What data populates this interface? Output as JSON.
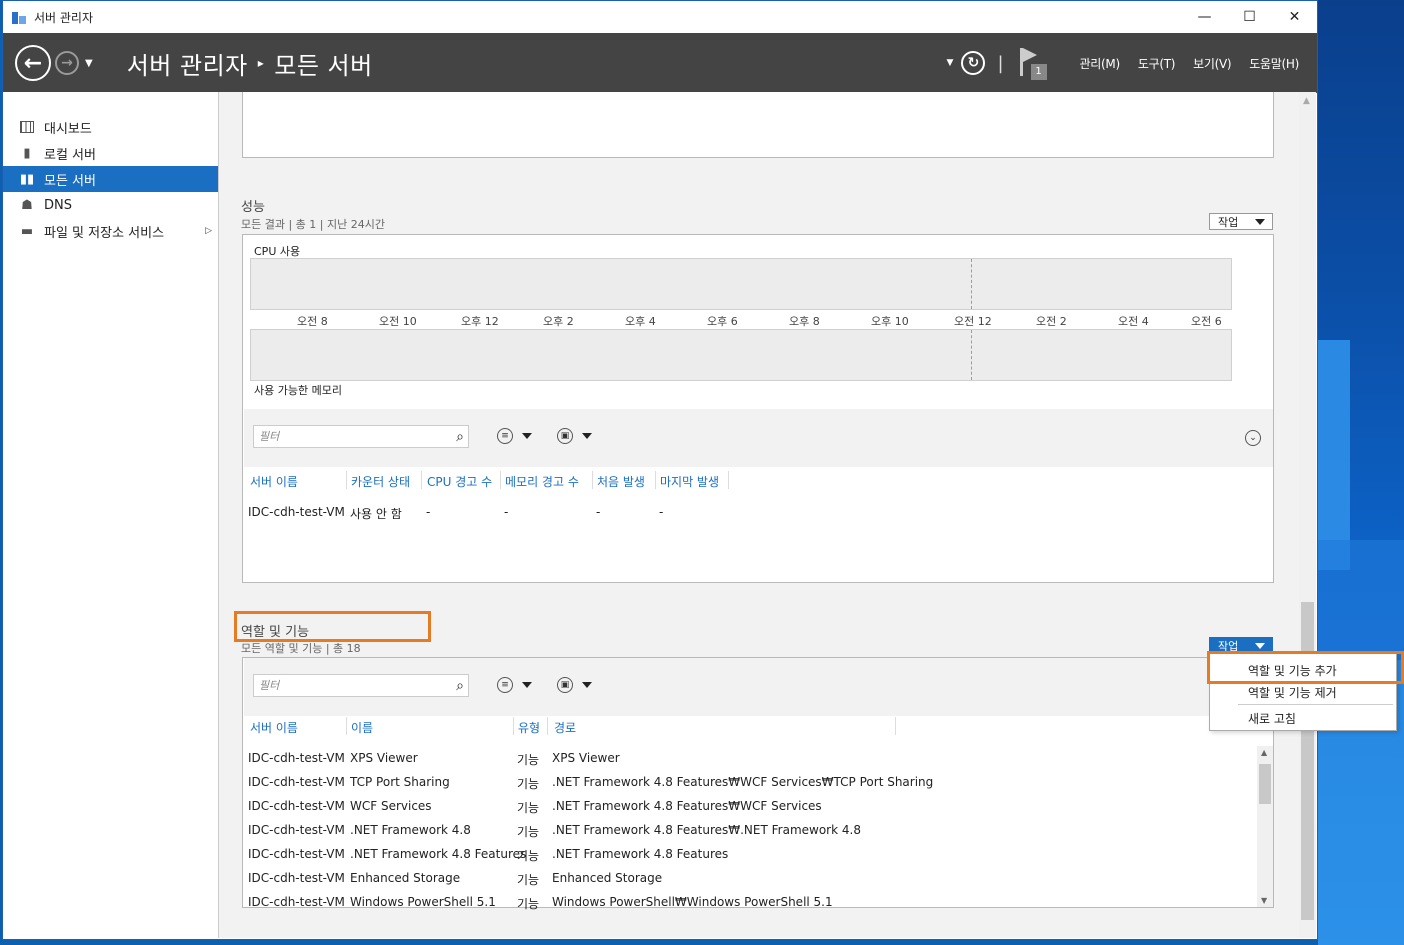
{
  "window": {
    "title": "서버 관리자",
    "minimize": "—",
    "maximize": "☐",
    "close": "✕"
  },
  "header": {
    "breadcrumb_root": "서버 관리자",
    "breadcrumb_sep": "▸",
    "breadcrumb_current": "모든 서버",
    "notification_count": "1",
    "menus": [
      "관리(M)",
      "도구(T)",
      "보기(V)",
      "도움말(H)"
    ]
  },
  "sidebar": {
    "items": [
      {
        "label": "대시보드",
        "icon": "dashboard-icon"
      },
      {
        "label": "로컬 서버",
        "icon": "server-icon"
      },
      {
        "label": "모든 서버",
        "icon": "servers-icon",
        "active": true
      },
      {
        "label": "DNS",
        "icon": "dns-icon"
      },
      {
        "label": "파일 및 저장소 서비스",
        "icon": "storage-icon",
        "has_submenu": true
      }
    ]
  },
  "performance": {
    "title": "성능",
    "subtitle": "모든 결과 | 총 1  |  지난 24시간",
    "task_label": "작업",
    "cpu_label": "CPU 사용",
    "memory_label": "사용 가능한 메모리",
    "time_ticks": [
      "오전 8",
      "오전 10",
      "오후 12",
      "오후 2",
      "오후 4",
      "오후 6",
      "오후 8",
      "오후 10",
      "오전 12",
      "오전 2",
      "오전 4",
      "오전 6"
    ],
    "filter_placeholder": "필터",
    "columns": [
      "서버 이름",
      "카운터 상태",
      "CPU 경고 수",
      "메모리 경고 수",
      "처음 발생",
      "마지막 발생"
    ],
    "rows": [
      [
        "IDC-cdh-test-VM",
        "사용 안 함",
        "-",
        "-",
        "-",
        "-"
      ]
    ]
  },
  "roles": {
    "title": "역할 및 기능",
    "subtitle": "모든 역할 및 기능 | 총 18",
    "task_label": "작업",
    "filter_placeholder": "필터",
    "columns": [
      "서버 이름",
      "이름",
      "유형",
      "경로"
    ],
    "rows": [
      [
        "IDC-cdh-test-VM",
        "XPS Viewer",
        "기능",
        "XPS Viewer"
      ],
      [
        "IDC-cdh-test-VM",
        "TCP Port Sharing",
        "기능",
        ".NET Framework 4.8 Features₩WCF Services₩TCP Port Sharing"
      ],
      [
        "IDC-cdh-test-VM",
        "WCF Services",
        "기능",
        ".NET Framework 4.8 Features₩WCF Services"
      ],
      [
        "IDC-cdh-test-VM",
        ".NET Framework 4.8",
        "기능",
        ".NET Framework 4.8 Features₩.NET Framework 4.8"
      ],
      [
        "IDC-cdh-test-VM",
        ".NET Framework 4.8 Features",
        "기능",
        ".NET Framework 4.8 Features"
      ],
      [
        "IDC-cdh-test-VM",
        "Enhanced Storage",
        "기능",
        "Enhanced Storage"
      ],
      [
        "IDC-cdh-test-VM",
        "Windows PowerShell 5.1",
        "기능",
        "Windows PowerShell₩Windows PowerShell 5.1"
      ]
    ]
  },
  "task_menu": {
    "items": [
      "역할 및 기능 추가",
      "역할 및 기능 제거",
      "새로 고침"
    ]
  },
  "colors": {
    "accent": "#1b6fc2",
    "header_bg": "#444444",
    "highlight": "#e57c25"
  }
}
